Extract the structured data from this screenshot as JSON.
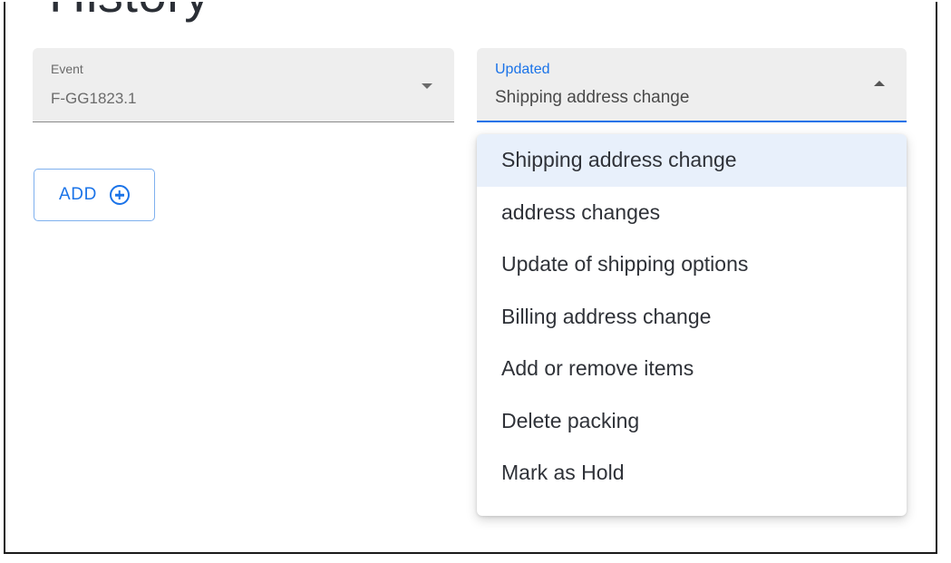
{
  "page": {
    "title": "History"
  },
  "event_field": {
    "label": "Event",
    "value": "F-GG1823.1"
  },
  "updated_field": {
    "label": "Updated",
    "value": "Shipping address change",
    "expanded": true
  },
  "add_button": {
    "label": "ADD",
    "icon": "add-circle-icon"
  },
  "dropdown": {
    "selected_index": 0,
    "options": [
      "Shipping address change",
      "address changes",
      "Update of shipping options",
      "Billing address change",
      "Add or remove items",
      "Delete packing",
      "Mark as Hold"
    ]
  },
  "colors": {
    "accent": "#1a73e8",
    "field_bg": "#eeeeee",
    "selected_bg": "#e8f0fb"
  }
}
